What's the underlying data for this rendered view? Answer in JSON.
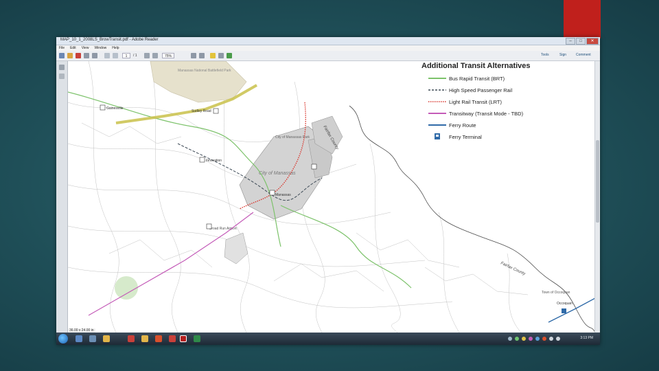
{
  "window": {
    "title": "MAP_10_1_2008LS_BrowTransit.pdf - Adobe Reader",
    "menu": [
      "File",
      "Edit",
      "View",
      "Window",
      "Help"
    ],
    "controls": {
      "minimize": "–",
      "maximize": "□",
      "close": "✕"
    }
  },
  "toolbar": {
    "page_current": "1",
    "page_total": "/ 1",
    "zoom": "75%",
    "tools_label": "Tools",
    "sign_label": "Sign",
    "comment_label": "Comment"
  },
  "legend": {
    "title": "Additional Transit Alternatives",
    "items": [
      {
        "label": "Bus Rapid Transit (BRT)",
        "color": "#7cc26a",
        "style": "solid"
      },
      {
        "label": "High Speed Passenger Rail",
        "color": "#3e4b57",
        "style": "dashed"
      },
      {
        "label": "Light Rail Transit (LRT)",
        "color": "#d9342b",
        "style": "dotted"
      },
      {
        "label": "Transitway (Transit Mode - TBD)",
        "color": "#c45bb8",
        "style": "solid"
      },
      {
        "label": "Ferry Route",
        "color": "#2f6aa8",
        "style": "solid"
      },
      {
        "label": "Ferry Terminal",
        "color": "#2f6aa8",
        "style": "icon"
      }
    ]
  },
  "map": {
    "labels": {
      "manassas_park": "Manassas National Battlefield Park",
      "gainesville": "Gainesville",
      "haymarket_station": "Sudley Road",
      "city_manassas": "City of Manassas",
      "manassas_park_city": "City of Manassas Park",
      "manassas_station": "Manassas",
      "innovation": "Innovation",
      "broad_run": "Broad Run Airport",
      "fairfax_county_1": "Fairfax County",
      "fairfax_county_2": "Fairfax County",
      "occoquan": "Town of Occoquan",
      "woodbridge": "Occoquan"
    }
  },
  "status": {
    "page_size": "36.00 x 24.00 in"
  },
  "taskbar": {
    "clock": "3:13 PM"
  },
  "colors": {
    "accent_red": "#c0201c",
    "background": "#1f4f58"
  }
}
